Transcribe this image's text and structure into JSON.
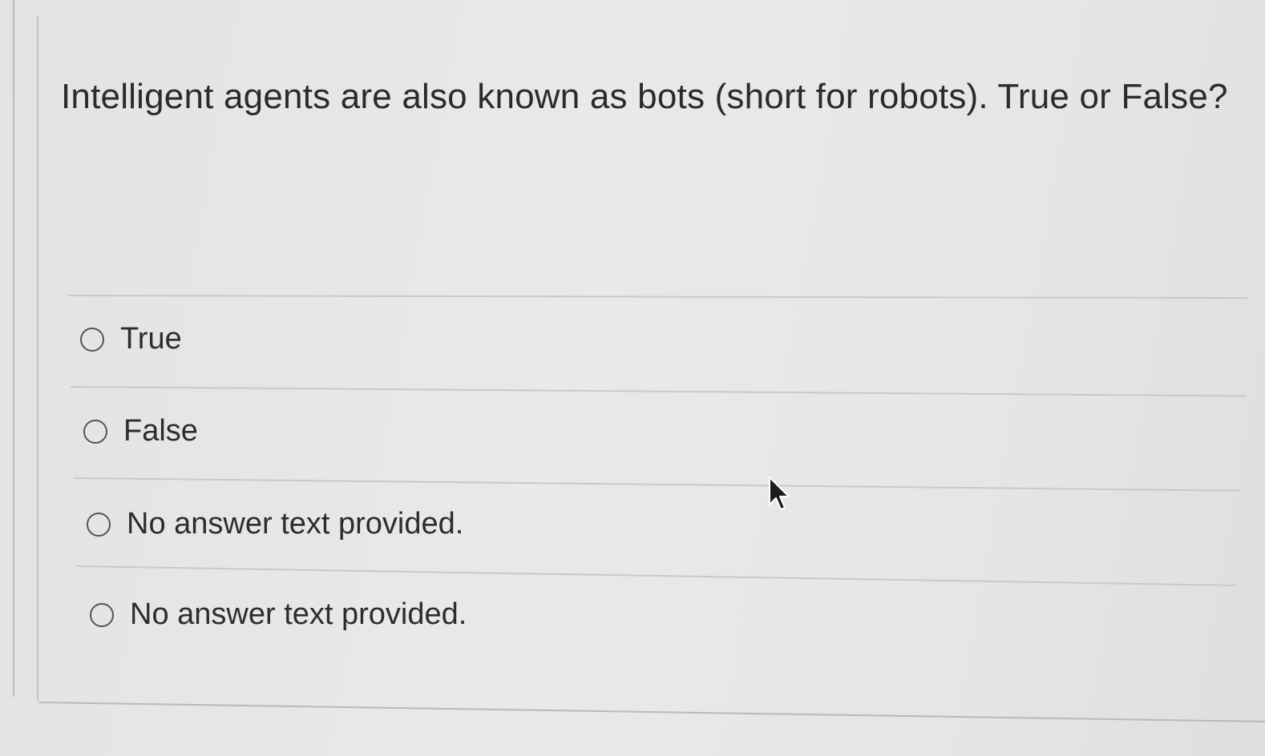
{
  "question": {
    "text": "Intelligent agents are also known as bots (short for robots). True or False?"
  },
  "options": [
    {
      "label": "True",
      "selected": false
    },
    {
      "label": "False",
      "selected": false
    },
    {
      "label": "No answer text provided.",
      "selected": false
    },
    {
      "label": "No answer text provided.",
      "selected": false
    }
  ],
  "icons": {
    "radio": "radio-button-icon",
    "cursor": "mouse-pointer-icon"
  },
  "colors": {
    "background": "#e6e6e4",
    "text": "#2d2d2d",
    "divider": "#c9c9c7"
  }
}
